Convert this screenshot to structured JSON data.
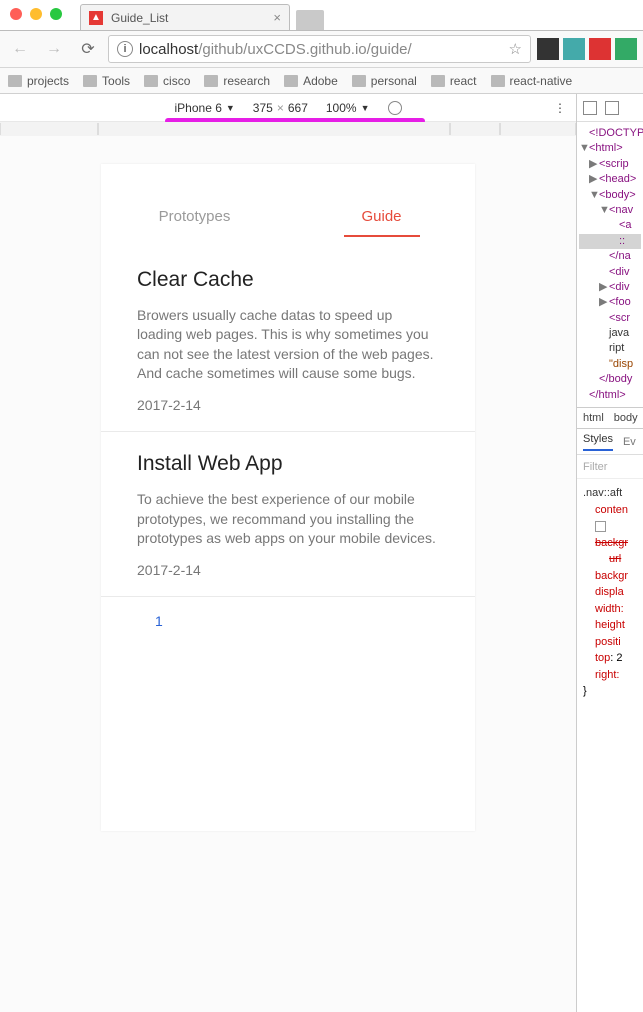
{
  "window": {
    "tab_title": "Guide_List"
  },
  "toolbar": {
    "url_host": "localhost",
    "url_path": "/github/uxCCDS.github.io/guide/"
  },
  "bookmarks": [
    "projects",
    "Tools",
    "cisco",
    "research",
    "Adobe",
    "personal",
    "react",
    "react-native"
  ],
  "device_toolbar": {
    "device": "iPhone 6",
    "width": "375",
    "height": "667",
    "zoom": "100%"
  },
  "page": {
    "tabs": [
      {
        "label": "Prototypes",
        "active": false
      },
      {
        "label": "Guide",
        "active": true
      }
    ],
    "articles": [
      {
        "title": "Clear Cache",
        "body": "Browers usually cache datas to speed up loading web pages. This is why sometimes you can not see the latest version of the web pages. And cache sometimes will cause some bugs.",
        "date": "2017-2-14"
      },
      {
        "title": "Install Web App",
        "body": "To achieve the best experience of our mobile prototypes, we recommand you installing the prototypes as web apps on your mobile devices.",
        "date": "2017-2-14"
      }
    ],
    "pager": "1"
  },
  "devtools": {
    "breadcrumb": [
      "html",
      "body"
    ],
    "styles_tabs": [
      "Styles",
      "Ev"
    ],
    "filter_placeholder": "Filter",
    "dom_lines": [
      {
        "ind": 0,
        "text": "<!DOCTYP"
      },
      {
        "ind": 0,
        "text": "<html>",
        "expand": "down"
      },
      {
        "ind": 10,
        "text": "<scrip",
        "expand": "right"
      },
      {
        "ind": 10,
        "text": "<head>",
        "expand": "right"
      },
      {
        "ind": 10,
        "text": "<body>",
        "expand": "down"
      },
      {
        "ind": 20,
        "text": "<nav",
        "expand": "down"
      },
      {
        "ind": 30,
        "text": "<a"
      },
      {
        "ind": 30,
        "text": "::",
        "sel": true
      },
      {
        "ind": 20,
        "text": "</na"
      },
      {
        "ind": 20,
        "text": "<div"
      },
      {
        "ind": 20,
        "text": "<div",
        "expand": "right"
      },
      {
        "ind": 20,
        "text": "<foo",
        "expand": "right"
      },
      {
        "ind": 20,
        "text": "<scr"
      },
      {
        "ind": 20,
        "text": "java",
        "plain": true
      },
      {
        "ind": 20,
        "text": "ript",
        "plain": true
      },
      {
        "ind": 20,
        "text": "\"disp",
        "attr": true
      },
      {
        "ind": 10,
        "text": "</body"
      },
      {
        "ind": 0,
        "text": "</html>"
      }
    ],
    "css_rule": {
      "selector": ".nav::aft",
      "props": [
        {
          "name": "conten",
          "struck": false
        },
        {
          "name": "backgr",
          "struck": true,
          "chk": true
        },
        {
          "name": "url",
          "struck": true,
          "indent": true
        },
        {
          "name": "backgr",
          "struck": false
        },
        {
          "name": "displa",
          "struck": false
        },
        {
          "name": "width:",
          "struck": false
        },
        {
          "name": "height",
          "struck": false
        },
        {
          "name": "positi",
          "struck": false
        },
        {
          "name": "top",
          "val": "2",
          "struck": false
        },
        {
          "name": "right:",
          "struck": false
        }
      ]
    }
  }
}
